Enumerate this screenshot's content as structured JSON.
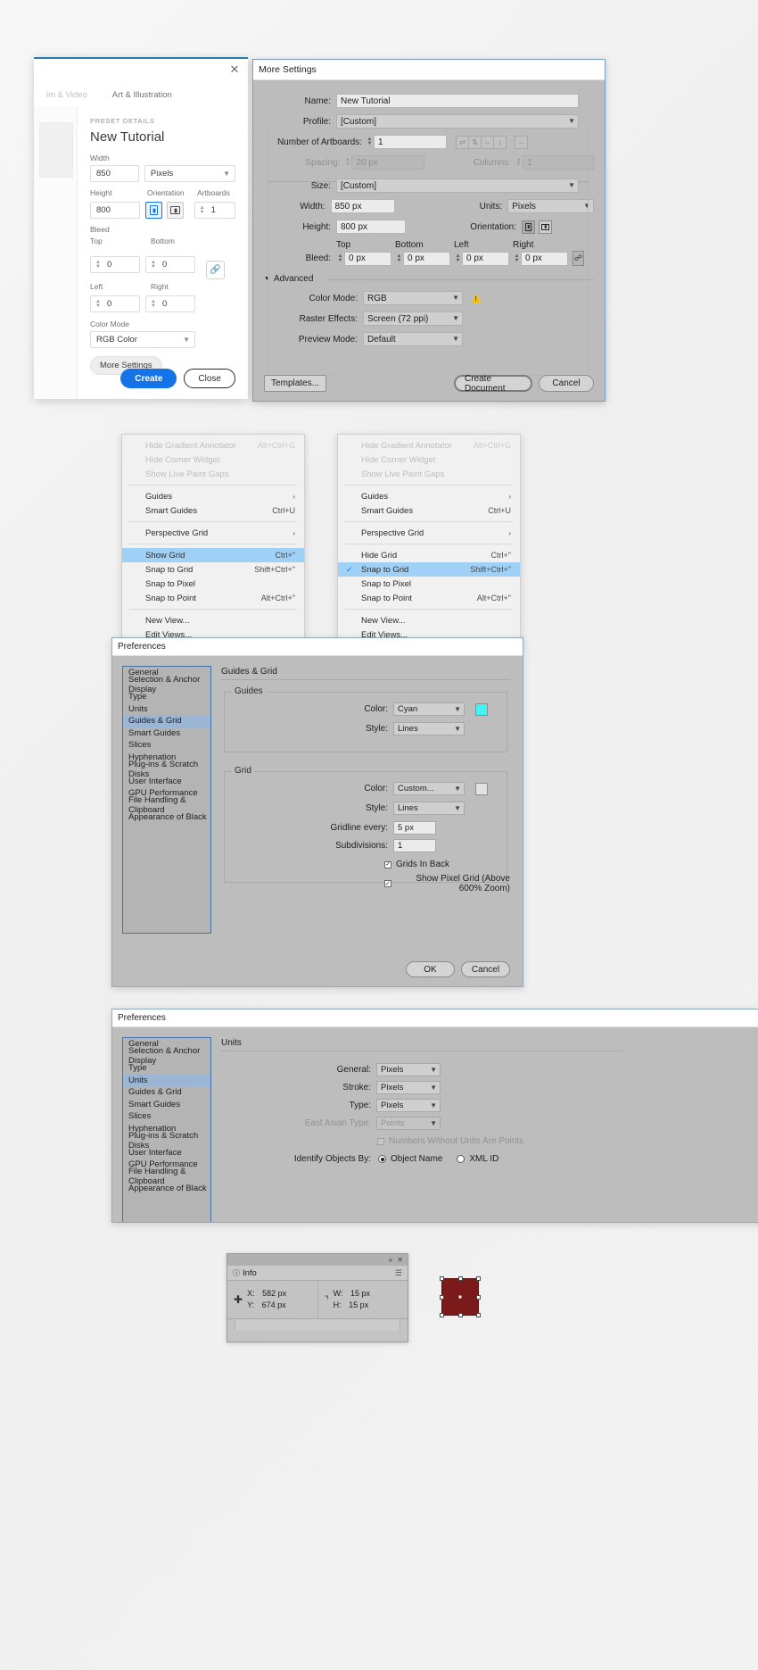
{
  "new_document_panel": {
    "close_icon": "close-icon",
    "tabs": [
      {
        "label": "lm & Video",
        "faded": true
      },
      {
        "label": "Art & Illustration",
        "faded": false
      }
    ],
    "preset_details_label": "PRESET DETAILS",
    "preset_name": "New Tutorial",
    "width_label": "Width",
    "width_value": "850",
    "units_value": "Pixels",
    "height_label": "Height",
    "height_value": "800",
    "orientation_label": "Orientation",
    "artboards_label": "Artboards",
    "artboards_value": "1",
    "bleed_label": "Bleed",
    "bleed_top_label": "Top",
    "bleed_top_value": "0",
    "bleed_bottom_label": "Bottom",
    "bleed_bottom_value": "0",
    "bleed_left_label": "Left",
    "bleed_left_value": "0",
    "bleed_right_label": "Right",
    "bleed_right_value": "0",
    "color_mode_label": "Color Mode",
    "color_mode_value": "RGB Color",
    "more_settings_label": "More Settings",
    "create_label": "Create",
    "close_label": "Close"
  },
  "more_settings": {
    "title": "More Settings",
    "name_label": "Name:",
    "name_value": "New Tutorial",
    "profile_label": "Profile:",
    "profile_value": "[Custom]",
    "artboards_label": "Number of Artboards:",
    "artboards_value": "1",
    "layout_icons": [
      "grid-by-row-icon",
      "grid-by-column-icon",
      "arrange-horizontal-icon",
      "arrange-vertical-icon"
    ],
    "rtl_icon": "right-to-left-icon",
    "spacing_label": "Spacing:",
    "spacing_value": "20 px",
    "columns_label": "Columns:",
    "columns_value": "1",
    "size_label": "Size:",
    "size_value": "[Custom]",
    "width_label": "Width:",
    "width_value": "850 px",
    "units_label": "Units:",
    "units_value": "Pixels",
    "height_label": "Height:",
    "height_value": "800 px",
    "orientation_label": "Orientation:",
    "bleed_label": "Bleed:",
    "bleed_top_label": "Top",
    "bleed_top_value": "0 px",
    "bleed_bottom_label": "Bottom",
    "bleed_bottom_value": "0 px",
    "bleed_left_label": "Left",
    "bleed_left_value": "0 px",
    "bleed_right_label": "Right",
    "bleed_right_value": "0 px",
    "chain_icon": "link-chain-icon",
    "advanced_label": "Advanced",
    "color_mode_label": "Color Mode:",
    "color_mode_value": "RGB",
    "warning_icon": "warning-triangle-icon",
    "raster_label": "Raster Effects:",
    "raster_value": "Screen (72 ppi)",
    "preview_label": "Preview Mode:",
    "preview_value": "Default",
    "templates_label": "Templates...",
    "create_document_label": "Create Document",
    "cancel_label": "Cancel"
  },
  "view_menu_left": {
    "items": [
      {
        "label": "Hide Gradient Annotator",
        "shortcut": "Alt+Ctrl+G",
        "state": "disabled"
      },
      {
        "label": "Hide Corner Widget",
        "shortcut": "",
        "state": "disabled"
      },
      {
        "label": "Show Live Paint Gaps",
        "shortcut": "",
        "state": "disabled"
      },
      {
        "sep": true
      },
      {
        "label": "Guides",
        "shortcut": "",
        "submenu": true
      },
      {
        "label": "Smart Guides",
        "shortcut": "Ctrl+U"
      },
      {
        "sep": true
      },
      {
        "label": "Perspective Grid",
        "shortcut": "",
        "submenu": true
      },
      {
        "sep": true
      },
      {
        "label": "Show Grid",
        "shortcut": "Ctrl+\"",
        "state": "selected"
      },
      {
        "label": "Snap to Grid",
        "shortcut": "Shift+Ctrl+\""
      },
      {
        "label": "Snap to Pixel",
        "shortcut": ""
      },
      {
        "label": "Snap to Point",
        "shortcut": "Alt+Ctrl+\""
      },
      {
        "sep": true
      },
      {
        "label": "New View...",
        "shortcut": ""
      },
      {
        "label": "Edit Views...",
        "shortcut": ""
      }
    ]
  },
  "view_menu_right": {
    "items": [
      {
        "label": "Hide Gradient Annotator",
        "shortcut": "Alt+Ctrl+G",
        "state": "disabled"
      },
      {
        "label": "Hide Corner Widget",
        "shortcut": "",
        "state": "disabled"
      },
      {
        "label": "Show Live Paint Gaps",
        "shortcut": "",
        "state": "disabled"
      },
      {
        "sep": true
      },
      {
        "label": "Guides",
        "shortcut": "",
        "submenu": true
      },
      {
        "label": "Smart Guides",
        "shortcut": "Ctrl+U"
      },
      {
        "sep": true
      },
      {
        "label": "Perspective Grid",
        "shortcut": "",
        "submenu": true
      },
      {
        "sep": true
      },
      {
        "label": "Hide Grid",
        "shortcut": "Ctrl+\""
      },
      {
        "label": "Snap to Grid",
        "shortcut": "Shift+Ctrl+\"",
        "state": "selected",
        "checked": true
      },
      {
        "label": "Snap to Pixel",
        "shortcut": ""
      },
      {
        "label": "Snap to Point",
        "shortcut": "Alt+Ctrl+\""
      },
      {
        "sep": true
      },
      {
        "label": "New View...",
        "shortcut": ""
      },
      {
        "label": "Edit Views...",
        "shortcut": ""
      }
    ]
  },
  "prefs_guides_grid": {
    "title": "Preferences",
    "nav_items": [
      {
        "label": "General"
      },
      {
        "label": "Selection & Anchor Display"
      },
      {
        "label": "Type"
      },
      {
        "label": "Units"
      },
      {
        "label": "Guides & Grid",
        "selected": true
      },
      {
        "label": "Smart Guides"
      },
      {
        "label": "Slices"
      },
      {
        "label": "Hyphenation"
      },
      {
        "label": "Plug-ins & Scratch Disks"
      },
      {
        "label": "User Interface"
      },
      {
        "label": "GPU Performance"
      },
      {
        "label": "File Handling & Clipboard"
      },
      {
        "label": "Appearance of Black"
      }
    ],
    "section_title": "Guides & Grid",
    "guides_legend": "Guides",
    "guides_color_label": "Color:",
    "guides_color_value": "Cyan",
    "guides_color_hex": "#44f4f4",
    "guides_style_label": "Style:",
    "guides_style_value": "Lines",
    "grid_legend": "Grid",
    "grid_color_label": "Color:",
    "grid_color_value": "Custom...",
    "grid_color_hex": "#e2e2e2",
    "grid_style_label": "Style:",
    "grid_style_value": "Lines",
    "gridline_label": "Gridline every:",
    "gridline_value": "5 px",
    "subdivisions_label": "Subdivisions:",
    "subdivisions_value": "1",
    "grids_in_back_label": "Grids In Back",
    "grids_in_back_checked": true,
    "pixel_grid_label": "Show Pixel Grid (Above 600% Zoom)",
    "pixel_grid_checked": true,
    "ok_label": "OK",
    "cancel_label": "Cancel"
  },
  "prefs_units": {
    "title": "Preferences",
    "nav_items": [
      {
        "label": "General"
      },
      {
        "label": "Selection & Anchor Display"
      },
      {
        "label": "Type"
      },
      {
        "label": "Units",
        "selected": true
      },
      {
        "label": "Guides & Grid"
      },
      {
        "label": "Smart Guides"
      },
      {
        "label": "Slices"
      },
      {
        "label": "Hyphenation"
      },
      {
        "label": "Plug-ins & Scratch Disks"
      },
      {
        "label": "User Interface"
      },
      {
        "label": "GPU Performance"
      },
      {
        "label": "File Handling & Clipboard"
      },
      {
        "label": "Appearance of Black"
      }
    ],
    "section_title": "Units",
    "general_label": "General:",
    "general_value": "Pixels",
    "stroke_label": "Stroke:",
    "stroke_value": "Pixels",
    "type_label": "Type:",
    "type_value": "Pixels",
    "east_asian_label": "East Asian Type:",
    "east_asian_value": "Points",
    "numbers_label": "Numbers Without Units Are Points",
    "identify_label": "Identify Objects By:",
    "radio_object_name": "Object Name",
    "radio_xml_id": "XML ID"
  },
  "info_panel": {
    "tab_label": "Info",
    "collapse_icon": "collapse-chevrons-icon",
    "close_icon": "close-icon",
    "menu_icon": "panel-menu-icon",
    "position_icon": "crosshair-icon",
    "size_icon": "bounding-box-icon",
    "x_label": "X:",
    "x_value": "582 px",
    "y_label": "Y:",
    "y_value": "674 px",
    "w_label": "W:",
    "w_value": "15 px",
    "h_label": "H:",
    "h_value": "15 px"
  },
  "selection_swatch": {
    "fill_hex": "#7b1a1a",
    "name": "selected-square-object"
  }
}
